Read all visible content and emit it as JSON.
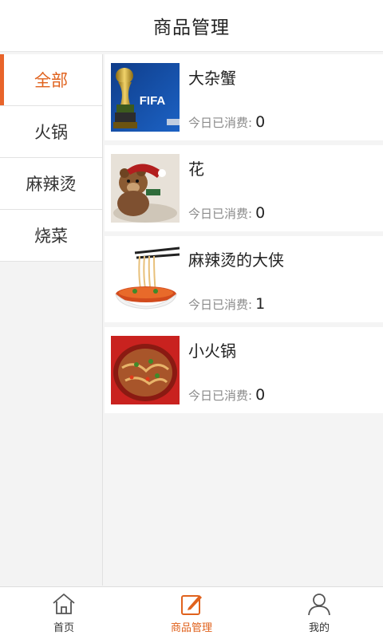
{
  "header": {
    "title": "商品管理"
  },
  "sidebar": {
    "categories": [
      {
        "label": "全部",
        "active": true
      },
      {
        "label": "火锅",
        "active": false
      },
      {
        "label": "麻辣烫",
        "active": false
      },
      {
        "label": "烧菜",
        "active": false
      }
    ]
  },
  "products": [
    {
      "name": "大杂蟹",
      "consume_label": "今日已消费:",
      "consume_value": "0",
      "image": "fifa-trophy-photo",
      "image_text": "FIFA"
    },
    {
      "name": "花",
      "consume_label": "今日已消费:",
      "consume_value": "0",
      "image": "teddy-bear-photo"
    },
    {
      "name": "麻辣烫的大侠",
      "consume_label": "今日已消费:",
      "consume_value": "1",
      "image": "noodle-bowl-photo"
    },
    {
      "name": "小火锅",
      "consume_label": "今日已消费:",
      "consume_value": "0",
      "image": "spicy-pot-photo"
    }
  ],
  "tabbar": {
    "tabs": [
      {
        "label": "首页",
        "icon": "home-icon",
        "active": false
      },
      {
        "label": "商品管理",
        "icon": "edit-icon",
        "active": true
      },
      {
        "label": "我的",
        "icon": "user-icon",
        "active": false
      }
    ]
  },
  "colors": {
    "accent": "#e0621d",
    "background": "#f4f4f4"
  }
}
